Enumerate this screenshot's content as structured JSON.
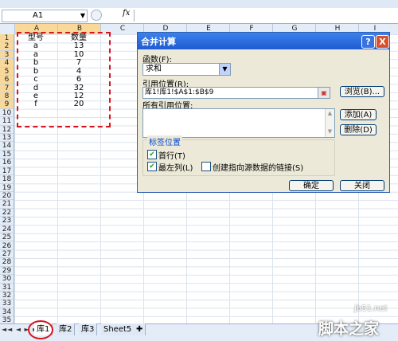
{
  "name_box": {
    "value": "A1"
  },
  "formula_bar": {
    "fx_label": "fx"
  },
  "columns": [
    "A",
    "B",
    "C",
    "D",
    "E",
    "F",
    "G",
    "H",
    "I"
  ],
  "rows": [
    "1",
    "2",
    "3",
    "4",
    "5",
    "6",
    "7",
    "8",
    "9",
    "10",
    "11",
    "12",
    "13",
    "14",
    "15",
    "16",
    "17",
    "18",
    "19",
    "20",
    "21",
    "22",
    "23",
    "24",
    "25",
    "26",
    "27",
    "28",
    "29",
    "30",
    "31",
    "32",
    "33",
    "34",
    "35"
  ],
  "sheet": {
    "headers": [
      "型号",
      "数量"
    ],
    "data": [
      [
        "a",
        "13"
      ],
      [
        "a",
        "10"
      ],
      [
        "b",
        "7"
      ],
      [
        "b",
        "4"
      ],
      [
        "c",
        "6"
      ],
      [
        "d",
        "32"
      ],
      [
        "e",
        "12"
      ],
      [
        "f",
        "20"
      ]
    ]
  },
  "dialog": {
    "title": "合并计算",
    "help": "?",
    "close": "X",
    "function_label": "函数(F):",
    "function_value": "求和",
    "reference_label": "引用位置(R):",
    "reference_value": "库1!库1!$A$1:$B$9",
    "browse_button": "浏览(B)...",
    "all_references_label": "所有引用位置:",
    "add_button": "添加(A)",
    "delete_button": "删除(D)",
    "label_position_title": "标签位置",
    "first_row_label": "首行(T)",
    "left_column_label": "最左列(L)",
    "link_source_label": "创建指向源数据的链接(S)",
    "ok_button": "确定",
    "close_button": "关闭"
  },
  "tabs": [
    "库1",
    "库2",
    "库3",
    "Sheet5"
  ],
  "active_tab": "库1",
  "watermark": {
    "site": "jb51.net",
    "brand": "脚本之家"
  },
  "colors": {
    "dialog_bg": "#ece9d8",
    "title_bar": "#1f5bd2",
    "annotation_red": "#d6141d",
    "header_bg": "#e4ecf7"
  }
}
